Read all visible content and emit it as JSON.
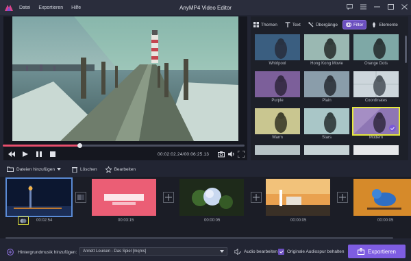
{
  "window": {
    "title": "AnyMP4 Video Editor",
    "menu": [
      "Datei",
      "Exportieren",
      "Hilfe"
    ]
  },
  "player": {
    "time_current": "00:02:02.24",
    "time_total": "00:06:25.13",
    "time_separator": "/",
    "progress": 0.32
  },
  "panel": {
    "tabs": [
      {
        "label": "Themen",
        "icon": "themes-grid-icon"
      },
      {
        "label": "Text",
        "icon": "text-icon"
      },
      {
        "label": "Übergänge",
        "icon": "transitions-icon"
      },
      {
        "label": "Filter",
        "icon": "filter-icon",
        "active": true
      },
      {
        "label": "Elemente",
        "icon": "elements-icon"
      }
    ],
    "filters": [
      "Whirlpool",
      "Hong Kong Movie",
      "Orange Dots",
      "Purple",
      "Plain",
      "Coordinates",
      "Warm",
      "Stars",
      "Modern"
    ],
    "selected_filter": "Modern"
  },
  "toolbar": {
    "add_files": "Dateien hinzufügen",
    "delete": "Löschen",
    "edit": "Bearbeiten"
  },
  "timeline": {
    "clips": [
      {
        "duration": "00:02:54"
      },
      {
        "duration": "00:03:15"
      },
      {
        "duration": "00:00:05"
      },
      {
        "duration": "00:00:05"
      },
      {
        "duration": "00:00:05"
      }
    ]
  },
  "footer": {
    "bg_music_label": "Hintergrundmusik hinzufügen:",
    "bg_music_value": "Annett Louisen - Das Spiel [mqms]",
    "edit_audio": "Audio bearbeiten",
    "keep_audio": "Originale Audiospur behalten",
    "export": "Exportieren"
  },
  "colors": {
    "accent": "#7e5de2",
    "selection": "#e6e93d",
    "progress": "#e84f6d"
  }
}
